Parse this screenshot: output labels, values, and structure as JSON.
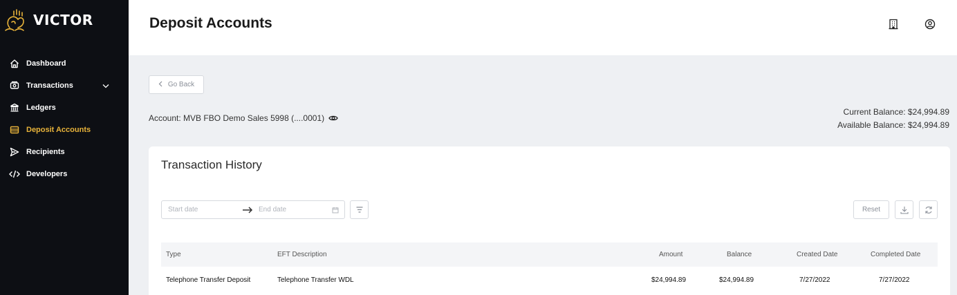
{
  "brand": {
    "name": "VICTOR",
    "accent": "#e8b33a",
    "sidebar_bg": "#0d0f14"
  },
  "sidebar": {
    "items": [
      {
        "label": "Dashboard",
        "icon": "home-icon",
        "active": false
      },
      {
        "label": "Transactions",
        "icon": "money-icon",
        "active": false,
        "expandable": true
      },
      {
        "label": "Ledgers",
        "icon": "bank-icon",
        "active": false
      },
      {
        "label": "Deposit Accounts",
        "icon": "wallet-icon",
        "active": true
      },
      {
        "label": "Recipients",
        "icon": "send-icon",
        "active": false
      },
      {
        "label": "Developers",
        "icon": "code-icon",
        "active": false
      }
    ]
  },
  "header": {
    "title": "Deposit Accounts",
    "icons": [
      "building-icon",
      "user-circle-icon"
    ]
  },
  "main": {
    "go_back": "Go Back",
    "account_label": "Account: MVB FBO Demo Sales 5998 (....0001)",
    "current_balance": "Current Balance: $24,994.89",
    "available_balance": "Available Balance: $24,994.89"
  },
  "history": {
    "title": "Transaction History",
    "start_placeholder": "Start date",
    "end_placeholder": "End date",
    "reset": "Reset",
    "columns": {
      "type": "Type",
      "description": "EFT Description",
      "amount": "Amount",
      "balance": "Balance",
      "created": "Created Date",
      "completed": "Completed Date"
    },
    "rows": [
      {
        "type": "Telephone Transfer Deposit",
        "description": "Telephone Transfer WDL",
        "amount": "$24,994.89",
        "balance": "$24,994.89",
        "created": "7/27/2022",
        "completed": "7/27/2022"
      }
    ]
  }
}
